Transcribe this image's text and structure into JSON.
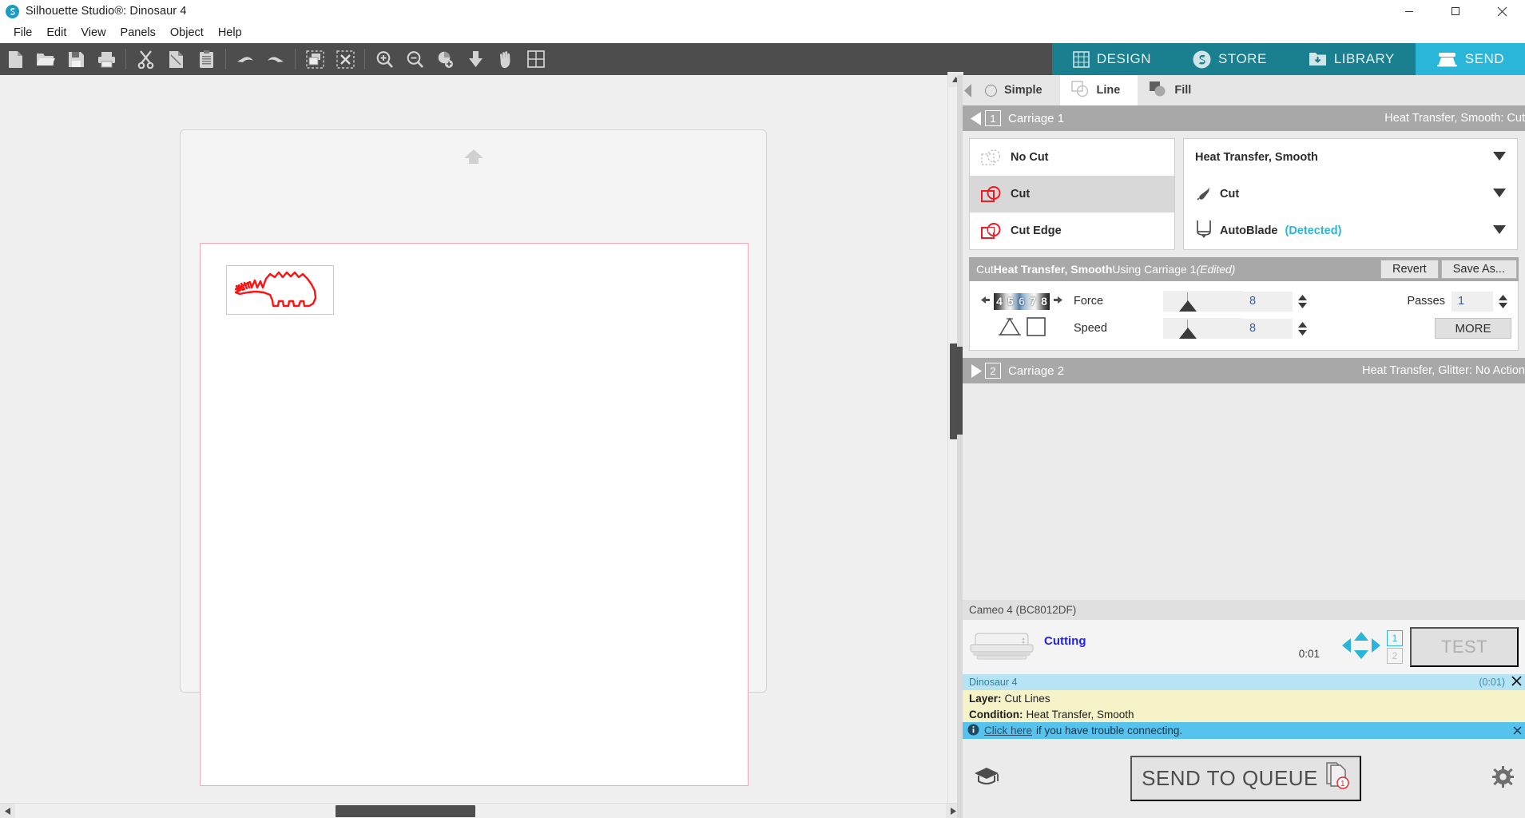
{
  "window": {
    "title": "Silhouette Studio®: Dinosaur 4",
    "logo_icon": "silhouette-logo-icon",
    "minimize_label": "Minimize",
    "maximize_label": "Maximize",
    "close_label": "Close"
  },
  "menu": {
    "items": [
      {
        "label": "File"
      },
      {
        "label": "Edit"
      },
      {
        "label": "View"
      },
      {
        "label": "Panels"
      },
      {
        "label": "Object"
      },
      {
        "label": "Help"
      }
    ]
  },
  "toolbar": {
    "groups": [
      {
        "buttons": [
          {
            "name": "new-document-icon",
            "tooltip": "New"
          },
          {
            "name": "open-folder-icon",
            "tooltip": "Open"
          },
          {
            "name": "save-icon",
            "tooltip": "Save"
          },
          {
            "name": "print-icon",
            "tooltip": "Print"
          }
        ]
      },
      {
        "buttons": [
          {
            "name": "cut-scissors-icon",
            "tooltip": "Cut"
          },
          {
            "name": "copy-icon",
            "tooltip": "Copy"
          },
          {
            "name": "paste-clipboard-icon",
            "tooltip": "Paste"
          }
        ]
      },
      {
        "buttons": [
          {
            "name": "undo-icon",
            "tooltip": "Undo"
          },
          {
            "name": "redo-icon",
            "tooltip": "Redo"
          }
        ]
      },
      {
        "buttons": [
          {
            "name": "select-all-icon",
            "tooltip": "Select All"
          },
          {
            "name": "deselect-all-icon",
            "tooltip": "Deselect All"
          }
        ]
      },
      {
        "buttons": [
          {
            "name": "zoom-in-icon",
            "tooltip": "Zoom In"
          },
          {
            "name": "zoom-out-icon",
            "tooltip": "Zoom Out"
          },
          {
            "name": "zoom-selection-icon",
            "tooltip": "Zoom to Selection"
          },
          {
            "name": "fit-to-window-icon",
            "tooltip": "Fit to Window"
          },
          {
            "name": "pan-hand-icon",
            "tooltip": "Pan"
          },
          {
            "name": "show-grid-icon",
            "tooltip": "Grid"
          }
        ]
      }
    ]
  },
  "mode_tabs": [
    {
      "label": "DESIGN",
      "icon": "grid-icon",
      "active": false
    },
    {
      "label": "STORE",
      "icon": "silhouette-logo-icon",
      "active": false
    },
    {
      "label": "LIBRARY",
      "icon": "folder-download-icon",
      "active": false
    },
    {
      "label": "SEND",
      "icon": "cutting-machine-icon",
      "active": true
    }
  ],
  "panel": {
    "tabs": [
      {
        "label": "Simple",
        "icon": "radio-circle-icon",
        "active": false
      },
      {
        "label": "Line",
        "icon": "line-shapes-icon",
        "active": true
      },
      {
        "label": "Fill",
        "icon": "fill-shapes-icon",
        "active": false
      }
    ],
    "carriage1": {
      "number": "1",
      "label": "Carriage 1",
      "summary": "Heat Transfer, Smooth: Cut",
      "expanded": true,
      "collapse_icon": "triangle-left-icon",
      "cut_modes": [
        {
          "label": "No Cut",
          "icon": "no-cut-icon",
          "selected": false
        },
        {
          "label": "Cut",
          "icon": "cut-icon",
          "selected": true
        },
        {
          "label": "Cut Edge",
          "icon": "cut-edge-icon",
          "selected": false
        }
      ],
      "material": {
        "label": "Heat Transfer, Smooth",
        "caret": "chevron-down-icon"
      },
      "action": {
        "label": "Cut",
        "icon": "blade-tip-icon",
        "caret": "chevron-down-icon"
      },
      "tool": {
        "label": "AutoBlade",
        "status": "(Detected)",
        "icon": "autoblade-icon",
        "caret": "chevron-down-icon"
      },
      "edit_bar": {
        "prefix": "Cut ",
        "material": "Heat Transfer, Smooth",
        "middle": " Using Carriage 1 ",
        "edited": "(Edited)",
        "revert_label": "Revert",
        "save_as_label": "Save As..."
      },
      "blade_depth": {
        "ticks": [
          "4",
          "5",
          "6",
          "7",
          "8"
        ],
        "highlighted": "6",
        "left_arrow": "arrow-left-icon",
        "right_arrow": "arrow-right-icon",
        "cone_icon": "blade-cone-icon",
        "square_icon": "blade-square-icon"
      },
      "force": {
        "label": "Force",
        "value": "8"
      },
      "speed": {
        "label": "Speed",
        "value": "8"
      },
      "passes": {
        "label": "Passes",
        "value": "1"
      },
      "more_label": "MORE"
    },
    "carriage2": {
      "number": "2",
      "label": "Carriage 2",
      "summary": "Heat Transfer, Glitter: No Action",
      "expanded": false,
      "expand_icon": "triangle-right-icon"
    },
    "device": {
      "name": "Cameo 4 (BC8012DF)",
      "machine_icon": "cameo-machine-icon",
      "status": "Cutting",
      "status_color": "#2020ff",
      "elapsed": "0:01",
      "dpad_icon": "dpad-arrows-icon",
      "carriage_chips": [
        {
          "label": "1",
          "active": true
        },
        {
          "label": "2",
          "active": false
        }
      ],
      "test_label": "TEST"
    },
    "job": {
      "title": "Dinosaur 4",
      "time": "(0:01)",
      "close_icon": "close-icon",
      "rows": [
        {
          "key": "Layer:",
          "value": "Cut Lines"
        },
        {
          "key": "Condition:",
          "value": "Heat Transfer, Smooth"
        }
      ]
    },
    "notice": {
      "icon": "info-icon",
      "link_text": "Click here",
      "text": "if you have trouble connecting.",
      "close_icon": "close-icon"
    },
    "send_bar": {
      "help_icon": "graduation-cap-icon",
      "send_label": "SEND TO QUEUE",
      "queue_icon": "stacked-pages-icon",
      "queue_badge": "1",
      "settings_icon": "gear-icon"
    }
  },
  "canvas": {
    "page_up_icon": "triangle-up-icon",
    "shape_name": "stegosaurus-dinosaur-shape",
    "cut_line_color": "#ff1111",
    "page_border_color": "#f2a8b4"
  },
  "colors": {
    "accent_teal": "#1a7f8e",
    "accent_cyan": "#29b6d8",
    "toolbar_dark": "#4d4d4d",
    "panel_bg": "#ebebeb",
    "header_gray": "#a8a8a8",
    "job_yellow": "#f7f3c8",
    "notice_blue": "#56c3ef"
  }
}
